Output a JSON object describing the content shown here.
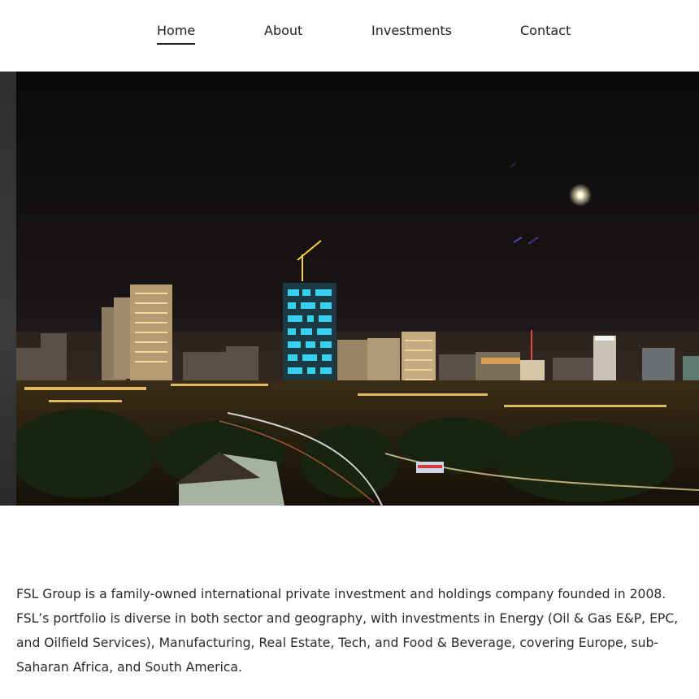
{
  "nav": {
    "items": [
      {
        "label": "Home",
        "active": true
      },
      {
        "label": "About",
        "active": false
      },
      {
        "label": "Investments",
        "active": false
      },
      {
        "label": "Contact",
        "active": false
      }
    ]
  },
  "hero": {
    "image_subject": "night city skyline with illuminated skyscrapers and moon"
  },
  "intro": {
    "text": "FSL Group is a family-owned international private investment and holdings company founded in 2008. FSL’s portfolio is diverse in both sector and geography, with investments in Energy (Oil & Gas E&P, EPC, and Oilfield Services), Manufacturing, Real Estate, Tech, and Food & Beverage, covering Europe, sub-Saharan Africa, and South America."
  },
  "colors": {
    "text": "#2a2a2a",
    "sky_top": "#0b0a0a",
    "sky_bottom": "#2a2220",
    "window_cyan": "#3ee0ff",
    "light_warm": "#ffc766"
  }
}
